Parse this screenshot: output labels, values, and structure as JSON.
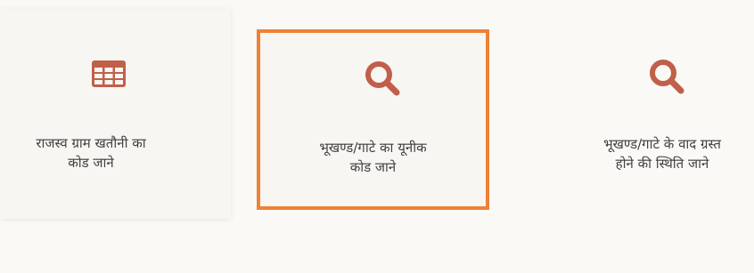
{
  "accent_color": "#c0604a",
  "highlight_border_color": "#ee8236",
  "cards": [
    {
      "icon": "table-icon",
      "label_line1": "राजस्व ग्राम खतौनी का",
      "label_line2": "कोड जाने",
      "selected": false
    },
    {
      "icon": "search-icon",
      "label_line1": "भूखण्ड/गाटे का यूनीक",
      "label_line2": "कोड जाने",
      "selected": true
    },
    {
      "icon": "search-icon",
      "label_line1": "भूखण्ड/गाटे के वाद ग्रस्त",
      "label_line2": "होने की स्थिति जाने",
      "selected": false
    }
  ]
}
